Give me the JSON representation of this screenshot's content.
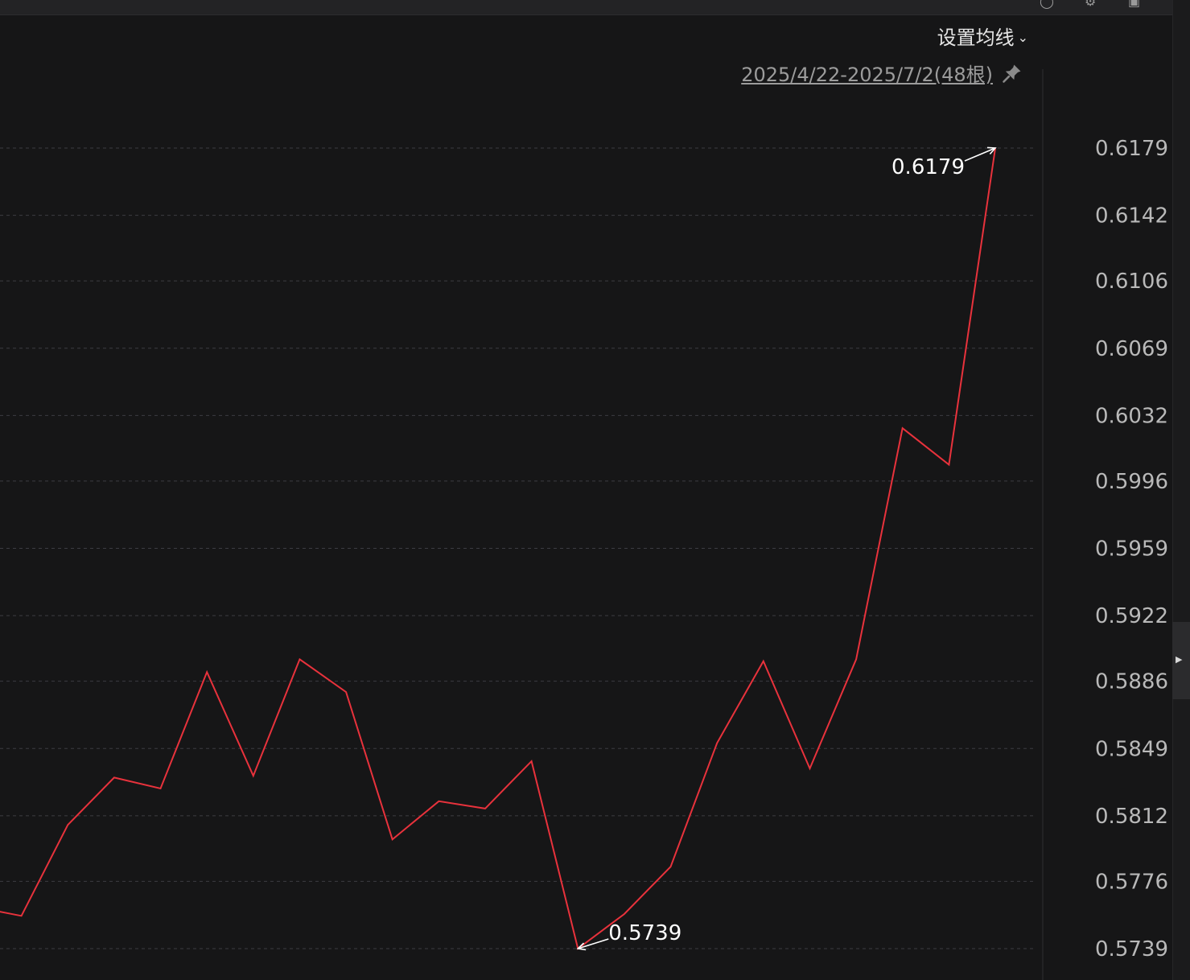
{
  "header": {
    "ma_settings_label": "设置均线",
    "date_range_label": "2025/4/22-2025/7/2(48根)"
  },
  "colors": {
    "background": "#161617",
    "line": "#e8323c",
    "grid": "#3c3c42",
    "tick_text": "#b9b9b9"
  },
  "chart_data": {
    "type": "line",
    "yticks": [
      "0.6179",
      "0.6142",
      "0.6106",
      "0.6069",
      "0.6032",
      "0.5996",
      "0.5959",
      "0.5922",
      "0.5886",
      "0.5849",
      "0.5812",
      "0.5776",
      "0.5739"
    ],
    "ylim": [
      0.5739,
      0.6179
    ],
    "grid": true,
    "series": [
      {
        "values": [
          0.5762,
          0.5757,
          0.5807,
          0.5833,
          0.5827,
          0.5891,
          0.5834,
          0.5898,
          0.588,
          0.5799,
          0.582,
          0.5816,
          0.5842,
          0.5739,
          0.5758,
          0.5784,
          0.5852,
          0.5897,
          0.5838,
          0.5898,
          0.6025,
          0.6005,
          0.6179
        ]
      }
    ],
    "annotations": [
      {
        "label": "0.6179",
        "index": 22,
        "value": 0.6179,
        "kind": "max"
      },
      {
        "label": "0.5739",
        "index": 13,
        "value": 0.5739,
        "kind": "min"
      }
    ]
  }
}
